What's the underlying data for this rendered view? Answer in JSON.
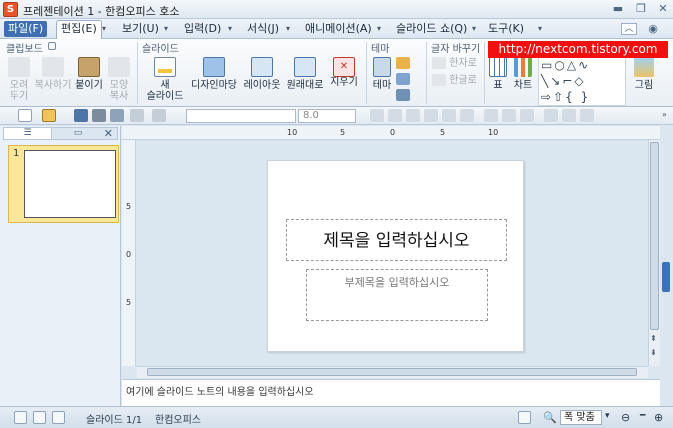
{
  "window": {
    "title": "프레젠테이션 1 - 한컴오피스 호소",
    "app_logo": "S"
  },
  "menu": {
    "file": "파일(F)",
    "items": [
      "편집(E)",
      "보기(U)",
      "입력(D)",
      "서식(J)",
      "애니메이션(A)",
      "슬라이드 쇼(Q)",
      "도구(K)"
    ]
  },
  "ribbon": {
    "clipboard": {
      "label": "클립보드",
      "cut": "오려\n두기",
      "copy": "복사하기",
      "paste": "붙이기",
      "format_copy": "모양\n복사"
    },
    "slide": {
      "label": "슬라이드",
      "new_slide": "새\n슬라이드",
      "design": "디자인마당",
      "layout": "레이아웃",
      "reset": "원래대로",
      "delete": "지우기"
    },
    "theme": {
      "label": "테마",
      "theme": "테마"
    },
    "text": {
      "label": "글자 바꾸기",
      "hanja": "한자로",
      "hangul": "한글로"
    },
    "insert": {
      "table": "표",
      "chart": "차트",
      "picture": "그림"
    }
  },
  "watermark": "http://nextcom.tistory.com",
  "toolbar": {
    "font_box": "",
    "font_size": "8.0"
  },
  "left_panel": {
    "slide_number": "1"
  },
  "ruler": {
    "h_labels": [
      "10",
      "5",
      "0",
      "5",
      "10"
    ],
    "v_labels": [
      "5",
      "0",
      "5"
    ]
  },
  "slide": {
    "title_placeholder": "제목을 입력하십시오",
    "subtitle_placeholder": "부제목을 입력하십시오"
  },
  "notes": {
    "placeholder": "여기에 슬라이드 노트의 내용을 입력하십시오"
  },
  "status": {
    "slide_counter": "슬라이드 1/1",
    "app_name": "한컴오피스",
    "zoom": "폭 맞춤"
  }
}
